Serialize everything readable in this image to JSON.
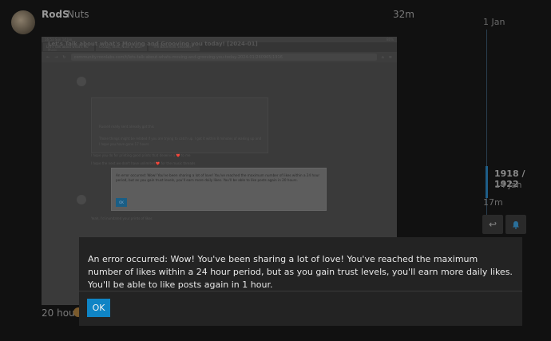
{
  "post": {
    "username": "RodS",
    "nickname": "Nuts",
    "age": "32m",
    "bottom_time": "20 hours"
  },
  "embedded_screenshot": {
    "status_time": "16:53",
    "status_date": "Sun 14 Jan",
    "status_right": "80%",
    "tabs": [
      "Let's Talk about what's Mo",
      "Crosby, Stills, Nash & Youn",
      "\"The Basement Sessions\""
    ],
    "url": "community.roonlabs.com/t/lets-talk-about-whats-moving-and-grooving-you-today-2024-01/260965/1916",
    "topic_title": "Let's Talk about what's Moving and Grooving you today! [2024-01]",
    "topic_category": "Music",
    "lines": [
      "Russell really sent already got this",
      "Those things might be related if you are trying to catch up. I got it within 8 minutes of waking up and",
      "I hope you have gone 17 hours",
      "I hope you do for printing good prints that deserve a ❤️ to me",
      "I hope the next we don't have unlimited ❤️ for the music threads",
      "Yeah, I'd inundated your prints of likes"
    ],
    "dialog_text": "An error occurred: Wow! You've been sharing a lot of love! You've reached the maximum number of likes within a 24 hour period, but as you gain trust levels, you'll earn more daily likes. You'll be able to like posts again in 20 hours.",
    "dialog_ok": "OK"
  },
  "timeline": {
    "top_date": "1 Jan",
    "position": "1918 / 1922",
    "position_date": "14 Jan",
    "bottom_age": "17m"
  },
  "modal": {
    "message": "An error occurred: Wow! You've been sharing a lot of love! You've reached the maximum number of likes within a 24 hour period, but as you gain trust levels, you'll earn more daily likes. You'll be able to like posts again in 1 hour.",
    "ok_label": "OK"
  },
  "colors": {
    "accent": "#0f84c5",
    "modal_bg": "#232323",
    "page_bg": "#111111"
  },
  "icons": {
    "reply": "reply-icon",
    "bell": "bell-icon"
  }
}
